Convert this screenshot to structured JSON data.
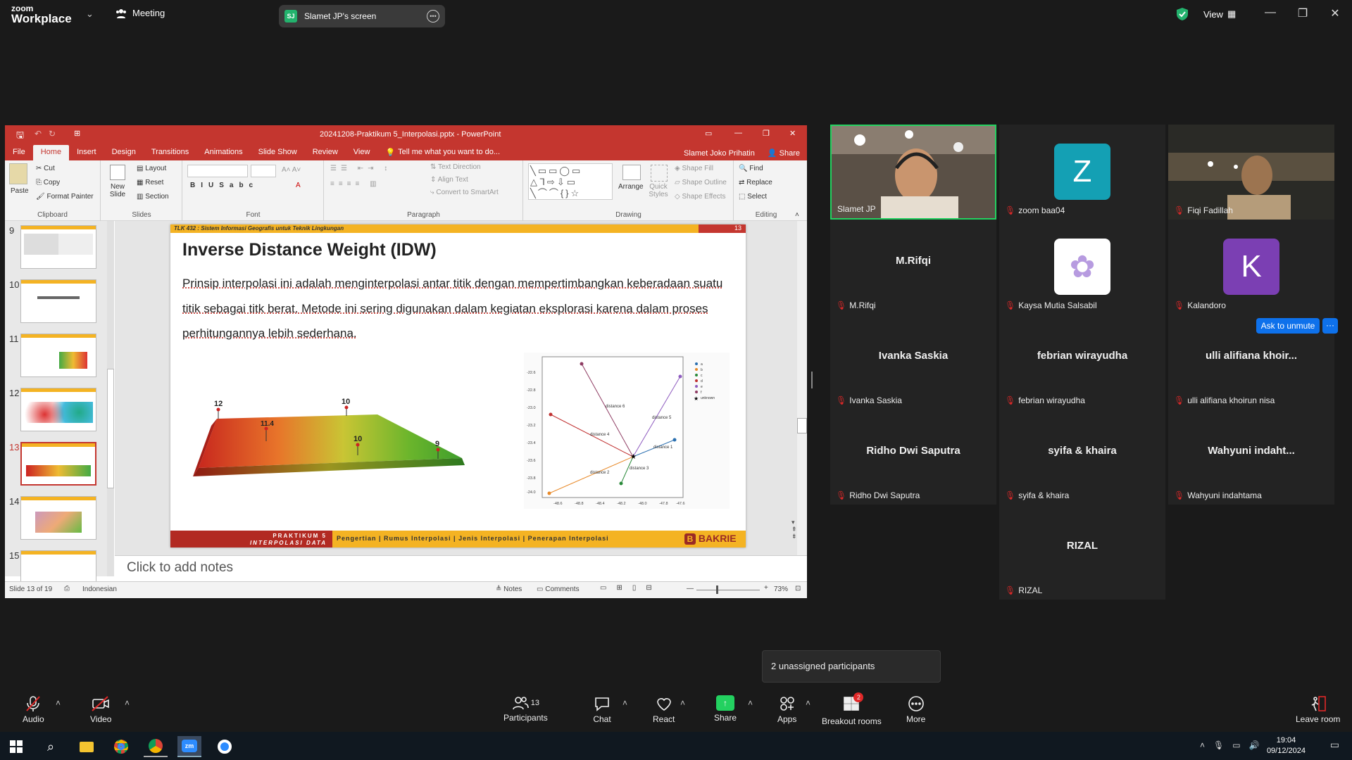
{
  "zoom": {
    "brand_line1": "zoom",
    "brand_line2": "Workplace",
    "meeting_label": "Meeting",
    "share_initials": "SJ",
    "share_label": "Slamet JP's screen",
    "view_label": "View"
  },
  "ppt": {
    "window_title": "20241208-Praktikum 5_Interpolasi.pptx - PowerPoint",
    "user": "Slamet Joko Prihatin",
    "share": "Share",
    "tabs": [
      "File",
      "Home",
      "Insert",
      "Design",
      "Transitions",
      "Animations",
      "Slide Show",
      "Review",
      "View"
    ],
    "tell_me": "Tell me what you want to do...",
    "ribbon": {
      "paste": "Paste",
      "cut": "Cut",
      "copy": "Copy",
      "format_painter": "Format Painter",
      "clipboard": "Clipboard",
      "new_slide": "New Slide",
      "layout": "Layout",
      "reset": "Reset",
      "section": "Section",
      "slides": "Slides",
      "font": "Font",
      "paragraph": "Paragraph",
      "text_direction": "Text Direction",
      "align_text": "Align Text",
      "convert": "Convert to SmartArt",
      "arrange": "Arrange",
      "quick_styles": "Quick Styles",
      "shape_fill": "Shape Fill",
      "shape_outline": "Shape Outline",
      "shape_effects": "Shape Effects",
      "drawing": "Drawing",
      "find": "Find",
      "replace": "Replace",
      "select": "Select",
      "editing": "Editing"
    },
    "thumb_numbers": [
      "9",
      "10",
      "11",
      "12",
      "13",
      "14",
      "15"
    ],
    "notes_placeholder": "Click to add notes",
    "status_slide": "Slide 13 of 19",
    "status_lang": "Indonesian",
    "status_notes": "Notes",
    "status_comments": "Comments",
    "zoom_pct": "73%"
  },
  "slide": {
    "header": "TLK 432 : Sistem Informasi Geografis untuk Teknik Lingkungan",
    "number": "13",
    "title": "Inverse Distance Weight (IDW)",
    "body": "Prinsip interpolasi ini adalah menginterpolasi antar titik dengan mempertimbangkan keberadaan suatu titik sebagai titk berat. Metode ini sering digunakan dalam kegiatan eksplorasi karena dalam proses perhitungannya lebih sederhana.",
    "footer_left1": "PRAKTIKUM 5",
    "footer_left2": "INTERPOLASI DATA",
    "footer_nav": "Pengertian  |  Rumus Interpolasi  |  Jenis Interpolasi  |  Penerapan Interpolasi",
    "brand": "BAKRIE",
    "surface_labels": [
      "12",
      "11.4",
      "10",
      "10",
      "9"
    ],
    "diagram_labels": [
      "distance 6",
      "distance 5",
      "distance 4",
      "distance 1",
      "distance 3",
      "distance 2"
    ],
    "legend": [
      "a",
      "b",
      "c",
      "d",
      "e",
      "f",
      "unknown"
    ],
    "y_ticks": [
      "-22.6",
      "-22.8",
      "-23.0",
      "-23.2",
      "-23.4",
      "-23.6",
      "-23.8",
      "-24.0"
    ],
    "x_ticks": [
      "-48.6",
      "-48.8",
      "-48.4",
      "-48.2",
      "-48.0",
      "-47.8",
      "-47.6"
    ]
  },
  "participants": [
    {
      "name": "Slamet JP",
      "type": "video",
      "muted": false,
      "active": true
    },
    {
      "name": "zoom baa04",
      "type": "avatar",
      "letter": "Z",
      "color": "#14a0b4",
      "muted": true
    },
    {
      "name": "Fiqi Fadillah",
      "type": "video",
      "muted": true
    },
    {
      "name": "M.Rifqi",
      "type": "text",
      "muted": true
    },
    {
      "name": "Kaysa Mutia Salsabil",
      "type": "avatar",
      "letter": "✿",
      "color": "#ffffff",
      "muted": true
    },
    {
      "name": "Kalandoro",
      "type": "avatar",
      "letter": "K",
      "color": "#7b3fb3",
      "muted": true
    },
    {
      "name": "Ivanka Saskia",
      "big": "Ivanka Saskia",
      "muted": true
    },
    {
      "name": "febrian wirayudha",
      "big": "febrian wirayudha",
      "muted": true
    },
    {
      "name": "ulli alifiana khoirun nisa",
      "big": "ulli  alifiana  khoir...",
      "muted": true
    },
    {
      "name": "Ridho Dwi Saputra",
      "big": "Ridho Dwi Saputra",
      "muted": true
    },
    {
      "name": "syifa & khaira",
      "big": "syifa & khaira",
      "muted": true
    },
    {
      "name": "Wahyuni indahtama",
      "big": "Wahyuni  indaht...",
      "muted": true
    },
    {
      "name": "RIZAL",
      "big": "RIZAL",
      "muted": true
    }
  ],
  "ask_unmute": "Ask to unmute",
  "unassigned": "2 unassigned participants",
  "toolbar": {
    "audio": "Audio",
    "video": "Video",
    "participants": "Participants",
    "participants_count": "13",
    "chat": "Chat",
    "react": "React",
    "share": "Share",
    "apps": "Apps",
    "breakout": "Breakout rooms",
    "breakout_badge": "2",
    "more": "More",
    "leave": "Leave room"
  },
  "taskbar": {
    "time": "19:04",
    "date": "09/12/2024"
  }
}
